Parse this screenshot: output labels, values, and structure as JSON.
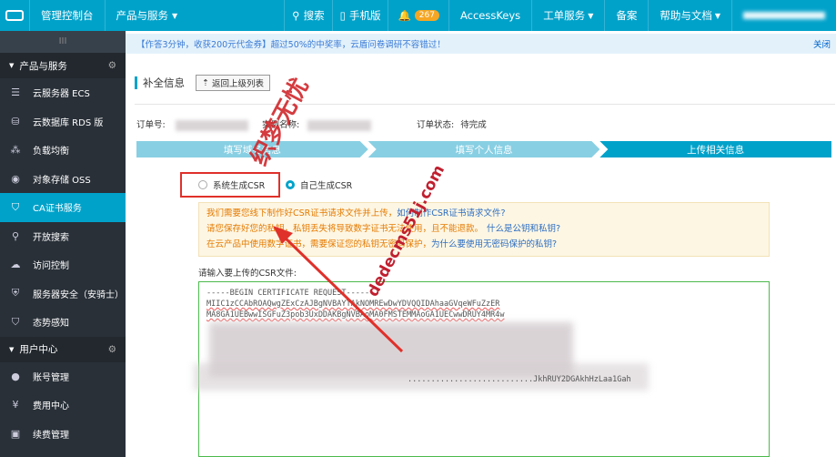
{
  "topbar": {
    "console": "管理控制台",
    "products": "产品与服务",
    "search": "搜索",
    "mobile": "手机版",
    "notify_count": "267",
    "accesskeys": "AccessKeys",
    "tickets": "工单服务",
    "beian": "备案",
    "help": "帮助与文档"
  },
  "sidebar": {
    "group1": "产品与服务",
    "items": [
      {
        "label": "云服务器 ECS",
        "icon": "server-icon"
      },
      {
        "label": "云数据库 RDS 版",
        "icon": "database-icon"
      },
      {
        "label": "负载均衡",
        "icon": "loadbalancer-icon"
      },
      {
        "label": "对象存储 OSS",
        "icon": "storage-icon"
      },
      {
        "label": "CA证书服务",
        "icon": "certificate-icon"
      },
      {
        "label": "开放搜索",
        "icon": "search-icon"
      },
      {
        "label": "访问控制",
        "icon": "cloud-icon"
      },
      {
        "label": "服务器安全（安骑士）",
        "icon": "shield-icon"
      },
      {
        "label": "态势感知",
        "icon": "shield-check-icon"
      }
    ],
    "group2": "用户中心",
    "items2": [
      {
        "label": "账号管理",
        "icon": "user-icon"
      },
      {
        "label": "费用中心",
        "icon": "yen-icon"
      },
      {
        "label": "续费管理",
        "icon": "bag-icon"
      }
    ]
  },
  "notice": {
    "text": "【作答3分钟，收获200元代金券】超过50%的中奖率，云盾问卷调研不容错过！",
    "close": "关闭"
  },
  "page": {
    "title": "补全信息",
    "back": "返回上级列表",
    "order_no_label": "订单号:",
    "instance_label": "实例名称:",
    "status_label": "订单状态:",
    "status_value": "待完成"
  },
  "steps": [
    "填写域名信息",
    "填写个人信息",
    "上传相关信息"
  ],
  "radios": {
    "system": "系统生成CSR",
    "self": "自己生成CSR"
  },
  "tip": {
    "line1_a": "我们需要您线下制作好CSR证书请求文件并上传，",
    "line1_b": "如何制作CSR证书请求文件?",
    "line2_a": "请您保存好您的私钥，私钥丢失将导致数字证书无法使用，",
    "line2_b": "且不能退款。",
    "line2_c": "什么是公钥和私钥?",
    "line3_a": "在云产品中使用数字证书，需要保证您的私钥无密码保护，",
    "line3_b": "为什么要使用无密码保护的私钥?"
  },
  "csr": {
    "label": "请输入要上传的CSR文件:",
    "line1": "-----BEGIN CERTIFICATE REQUEST-----",
    "line2": "MIIC1zCCAbROAQwgZExCzAJBgNVBAYTAkNOMREwDwYDVQQIDAhaaGVqeWFuZzER",
    "line3": "MA8GA1UEBwwISGFuZ3pob3UxDDAKBgNVBAoMA0FMSTEMMAoGA1UECwwDRUY4MR4w",
    "line4": "...........................JkhRUY2DGAkhHzLaa1Gah"
  },
  "watermark": {
    "main": "织梦无忧",
    "url": "dedecms51j.com"
  }
}
